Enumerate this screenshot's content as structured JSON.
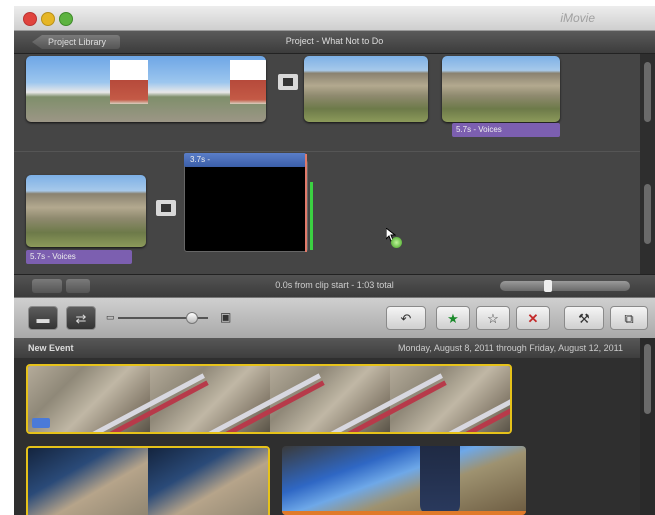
{
  "window": {
    "app_title": "iMovie"
  },
  "project": {
    "library_button": "Project Library",
    "title": "Project - What Not to Do",
    "voice_label_1": "5.7s - Voices",
    "voice_label_2": "5.7s - Voices",
    "title_clip_label": "3.7s -"
  },
  "status": {
    "text": "0.0s from clip start - 1:03 total"
  },
  "toolbar": {
    "icons": [
      "camera-icon",
      "swap-icon",
      "zoom-slider",
      "screen-icon",
      "back-arrow-icon",
      "favorite-star-icon",
      "unmark-star-icon",
      "reject-x-icon",
      "tools-icon",
      "crop-icon"
    ],
    "glyphs": {
      "star": "★",
      "star_outline": "☆",
      "reject": "✕",
      "tools": "⚒",
      "crop": "⧉",
      "back": "↶"
    }
  },
  "event": {
    "name": "New Event",
    "date_range": "Monday, August 8, 2011 through Friday, August 12, 2011"
  },
  "colors": {
    "accent": "#e6c21a",
    "voice": "#7c5fb0",
    "title_bar": "#3b5ea8",
    "playhead": "#e07a6a",
    "green_marker": "#3bd142"
  }
}
